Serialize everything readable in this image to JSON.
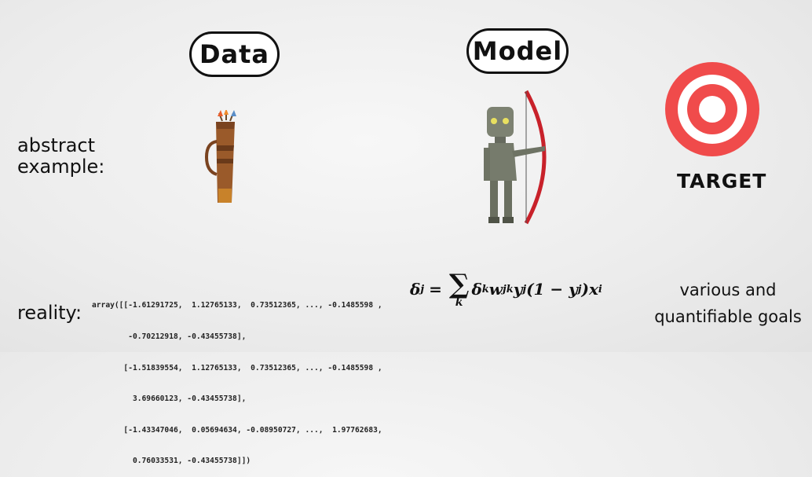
{
  "headers": {
    "data": "Data",
    "model": "Model"
  },
  "rows": {
    "abstract": "abstract\nexample:",
    "reality": "reality:"
  },
  "target": {
    "label": "TARGET"
  },
  "reality_code": {
    "lines": [
      "array([[-1.61291725,  1.12765133,  0.73512365, ..., -0.1485598 ,",
      "        -0.70212918, -0.43455738],",
      "       [-1.51839554,  1.12765133,  0.73512365, ..., -0.1485598 ,",
      "         3.69660123, -0.43455738],",
      "       [-1.43347046,  0.05694634, -0.08950727, ...,  1.97762683,",
      "         0.76033531, -0.43455738]])"
    ]
  },
  "formula": {
    "lhs": "δ",
    "lhs_sub": "j",
    "eq": "=",
    "sigma": "∑",
    "sum_index": "k",
    "t1": "δ",
    "t1_sub": "k",
    "t2": "w",
    "t2_sub": "jk",
    "t3": "y",
    "t3_sub": "j",
    "t4": "(1 − y",
    "t4_sub": "j",
    "t5": ")x",
    "t5_sub": "i"
  },
  "goals": "various and\nquantifiable goals",
  "icons": {
    "quiver": "quiver-icon",
    "robot_archer": "robot-archer-icon",
    "target": "target-icon"
  },
  "colors": {
    "target_red": "#f04b4b",
    "quiver_brown": "#9a5a2a",
    "bow_red": "#c8212a",
    "robot_grey": "#7d8272"
  }
}
